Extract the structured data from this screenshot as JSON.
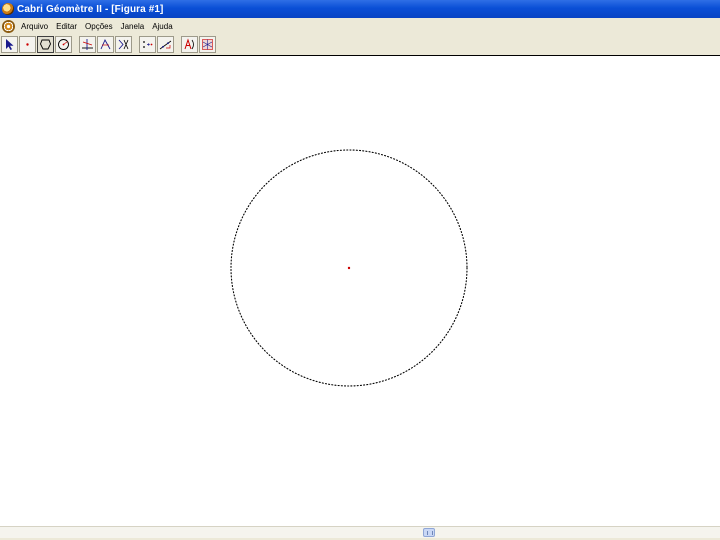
{
  "window": {
    "title": "Cabri Géomètre II - [Figura #1]",
    "app_icon": "cabri-app-icon"
  },
  "menubar": {
    "logo_icon": "cabri-logo-icon",
    "items": [
      "Arquivo",
      "Editar",
      "Opções",
      "Janela",
      "Ajuda"
    ]
  },
  "toolbar": {
    "tools": [
      {
        "icon": "pointer-icon",
        "active": false
      },
      {
        "icon": "point-icon",
        "active": false
      },
      {
        "icon": "polygon-icon",
        "active": true
      },
      {
        "icon": "circle-icon",
        "active": false
      },
      {
        "icon": "perpendicular-line-icon",
        "active": false
      },
      {
        "icon": "locus-icon",
        "active": false
      },
      {
        "icon": "symmetry-icon",
        "active": false
      },
      {
        "icon": "collinear-check-icon",
        "active": false
      },
      {
        "icon": "measure-icon",
        "active": false
      },
      {
        "icon": "label-text-icon",
        "active": false
      },
      {
        "icon": "display-options-icon",
        "active": false
      }
    ]
  },
  "figure": {
    "circle_style": "dotted",
    "circle_color": "#000000",
    "center_point_color": "#cc0000"
  },
  "colors": {
    "titlebar": "#0a4fd6",
    "chrome": "#ece9d8",
    "canvas": "#ffffff"
  }
}
